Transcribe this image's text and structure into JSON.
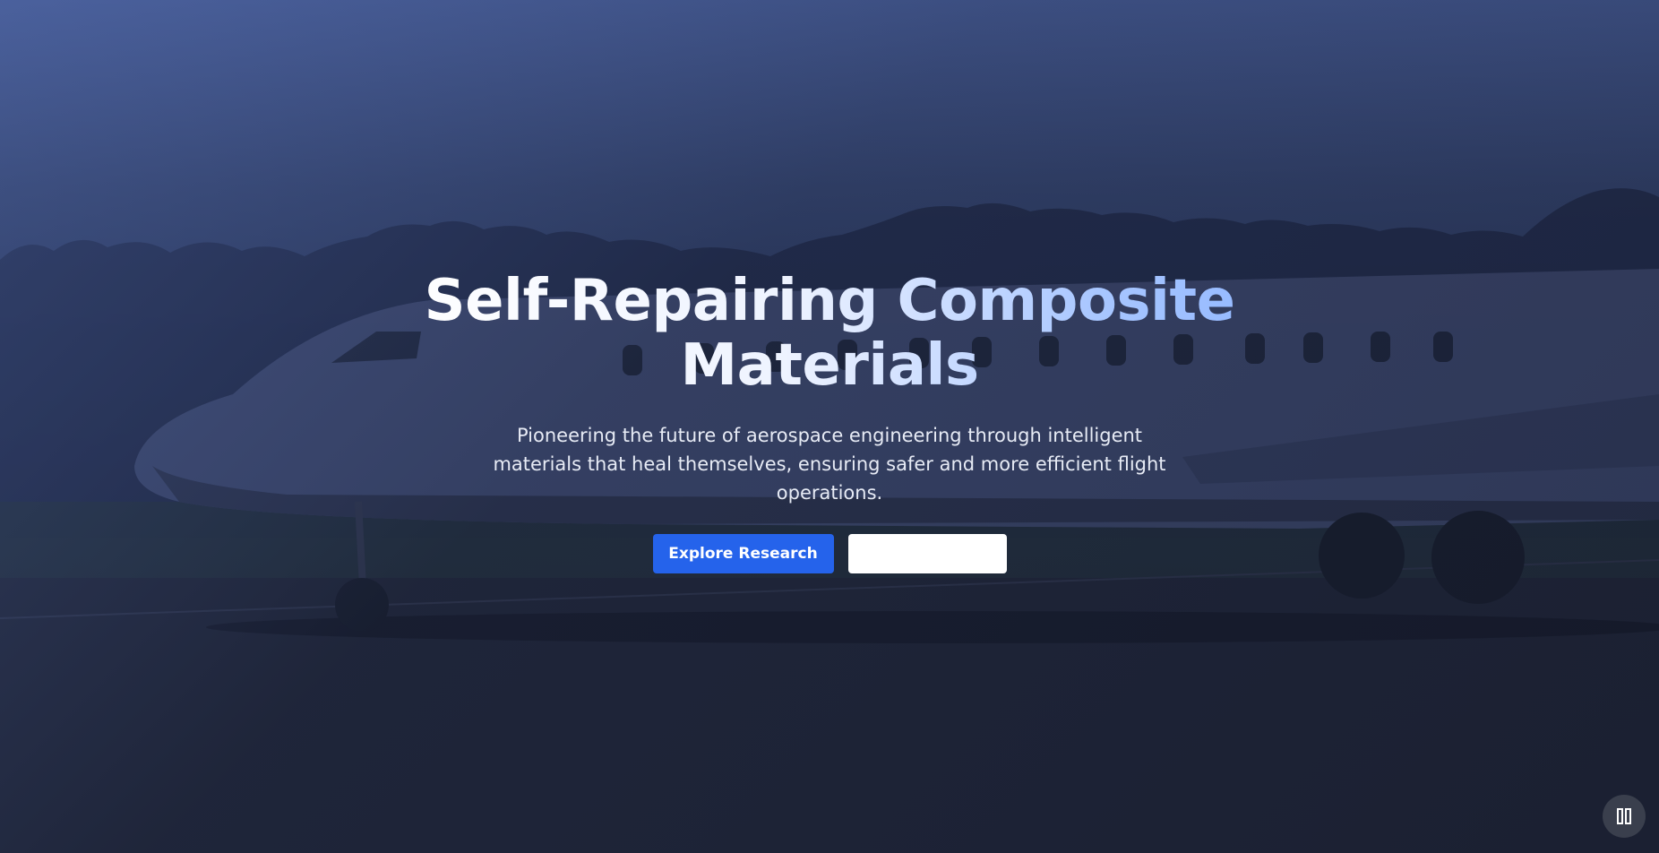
{
  "hero": {
    "title": "Self-Repairing Composite Materials",
    "subtitle": "Pioneering the future of aerospace engineering through intelligent materials that heal themselves, ensuring safer and more efficient flight operations.",
    "primary_button_label": "Explore Research",
    "secondary_button_label": ""
  },
  "background": {
    "image_subject": "business jet on runway at dusk with treeline",
    "overlay_color": "#3f5286"
  },
  "controls": {
    "pause_icon": "pause-icon"
  },
  "colors": {
    "primary": "#2563eb",
    "title_gradient_end": "#93b8ff"
  }
}
